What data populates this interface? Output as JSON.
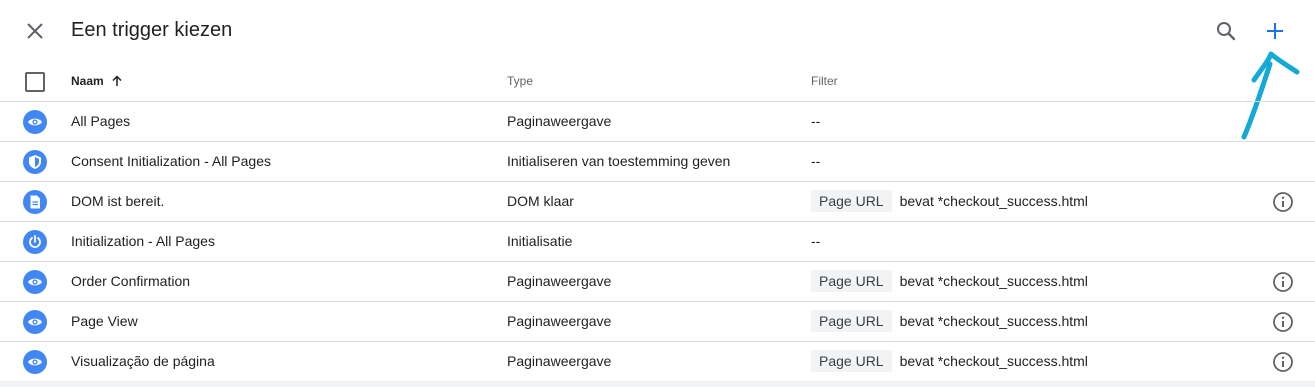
{
  "header": {
    "title": "Een trigger kiezen",
    "icons": {
      "close": "close-icon",
      "search": "search-icon",
      "add": "plus-icon"
    },
    "accent_color": "#1a73e8",
    "annotation_color": "#14a9d6"
  },
  "columns": {
    "name": "Naam",
    "type": "Type",
    "filter": "Filter"
  },
  "triggers": [
    {
      "icon": "eye-icon",
      "name": "All Pages",
      "type": "Paginaweergave",
      "filter_text": "--"
    },
    {
      "icon": "shield-icon",
      "name": "Consent Initialization - All Pages",
      "type": "Initialiseren van toestemming geven",
      "filter_text": "--"
    },
    {
      "icon": "document-icon",
      "name": "DOM ist bereit.",
      "type": "DOM klaar",
      "filter_var": "Page URL",
      "filter_cond": "bevat *checkout_success.html"
    },
    {
      "icon": "power-icon",
      "name": "Initialization - All Pages",
      "type": "Initialisatie",
      "filter_text": "--"
    },
    {
      "icon": "eye-icon",
      "name": "Order Confirmation",
      "type": "Paginaweergave",
      "filter_var": "Page URL",
      "filter_cond": "bevat *checkout_success.html"
    },
    {
      "icon": "eye-icon",
      "name": "Page View",
      "type": "Paginaweergave",
      "filter_var": "Page URL",
      "filter_cond": "bevat *checkout_success.html"
    },
    {
      "icon": "eye-icon",
      "name": "Visualização de página",
      "type": "Paginaweergave",
      "filter_var": "Page URL",
      "filter_cond": "bevat *checkout_success.html"
    }
  ],
  "icon_color": "#4285f4"
}
